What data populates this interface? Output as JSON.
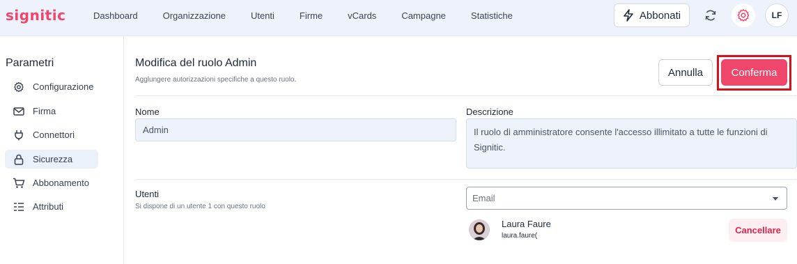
{
  "app": {
    "logo": "signitic",
    "brand_color": "#f0466b"
  },
  "nav": {
    "items": [
      "Dashboard",
      "Organizzazione",
      "Utenti",
      "Firme",
      "vCards",
      "Campagne",
      "Statistiche"
    ]
  },
  "header": {
    "subscribe_label": "Abbonati",
    "avatar_initials": "LF"
  },
  "sidebar": {
    "title": "Parametri",
    "items": [
      {
        "label": "Configurazione",
        "icon": "gear-icon"
      },
      {
        "label": "Firma",
        "icon": "mail-icon"
      },
      {
        "label": "Connettori",
        "icon": "plug-icon"
      },
      {
        "label": "Sicurezza",
        "icon": "lock-icon",
        "active": true
      },
      {
        "label": "Abbonamento",
        "icon": "cart-icon"
      },
      {
        "label": "Attributi",
        "icon": "list-icon"
      }
    ]
  },
  "main": {
    "title": "Modifica del ruolo Admin",
    "subtitle": "Agglungere autorizzazioni specifiche a questo ruolo.",
    "cancel_label": "Annulla",
    "confirm_label": "Conferma",
    "name_label": "Nome",
    "name_value": "Admin",
    "description_label": "Descrizione",
    "description_value": "Il ruolo di amministratore consente l'accesso illimitato a tutte le funzioni di Signitic.",
    "users_label": "Utenti",
    "users_subtitle": "Si dispone di un utente 1 con questo ruolo",
    "email_placeholder": "Email",
    "user": {
      "name": "Laura Faure",
      "email": "laura.faure(",
      "delete_label": "Cancellare"
    }
  }
}
